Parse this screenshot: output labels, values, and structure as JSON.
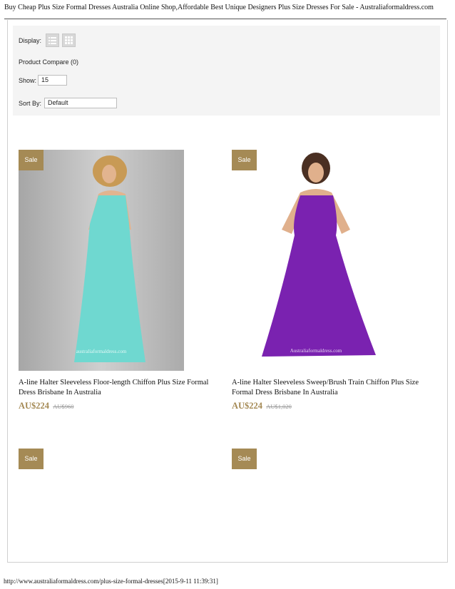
{
  "page_title": "Buy Cheap Plus Size Formal Dresses Australia Online Shop,Affordable Best Unique Designers Plus Size Dresses For Sale - Australiaformaldress.com",
  "toolbar": {
    "display_label": "Display:",
    "display_options": [
      {
        "icon": "list-view-icon"
      },
      {
        "icon": "grid-view-icon"
      }
    ],
    "compare_text": "Product Compare (0)",
    "show_label": "Show:",
    "show_value": "15",
    "sort_label": "Sort By:",
    "sort_value": "Default"
  },
  "products": [
    {
      "badge": "Sale",
      "name": "A-line Halter Sleeveless Floor-length Chiffon Plus Size Formal Dress Brisbane In Australia",
      "price": "AU$224",
      "old_price": "AU$960",
      "dress_color": "#6fd8d0",
      "watermark": "australiaformaldress.com"
    },
    {
      "badge": "Sale",
      "name": "A-line Halter Sleeveless Sweep/Brush Train Chiffon Plus Size Formal Dress Brisbane In Australia",
      "price": "AU$224",
      "old_price": "AU$1,020",
      "dress_color": "#7a22b0",
      "watermark": "Australiaformaldress.com"
    },
    {
      "badge": "Sale"
    },
    {
      "badge": "Sale"
    }
  ],
  "colors": {
    "sale_badge": "#a58a55",
    "price": "#a58a55",
    "toolbar_bg": "#f4f4f4"
  },
  "footer": "http://www.australiaformaldress.com/plus-size-formal-dresses[2015-9-11 11:39:31]"
}
